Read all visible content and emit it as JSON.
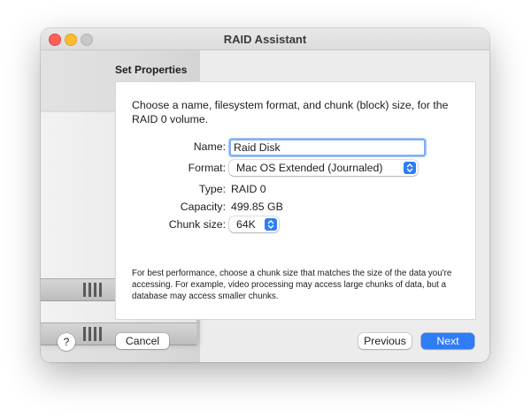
{
  "window": {
    "title": "RAID Assistant"
  },
  "panel": {
    "heading": "Set Properties",
    "intro": "Choose a name, filesystem format, and chunk (block) size, for the RAID 0 volume.",
    "note": "For best performance, choose a chunk size that matches the size of the data you're accessing. For example, video processing may access large chunks of data, but a database may access smaller chunks."
  },
  "form": {
    "name_label": "Name:",
    "name_value": "Raid Disk",
    "format_label": "Format:",
    "format_value": "Mac OS Extended (Journaled)",
    "type_label": "Type:",
    "type_value": "RAID 0",
    "capacity_label": "Capacity:",
    "capacity_value": "499.85 GB",
    "chunk_label": "Chunk size:",
    "chunk_value": "64K"
  },
  "buttons": {
    "help": "?",
    "cancel": "Cancel",
    "previous": "Previous",
    "next": "Next"
  },
  "colors": {
    "accent": "#2f7cf6",
    "close": "#ff5f57",
    "minimize": "#febc2e",
    "focus_ring": "#7fb0f5"
  },
  "icons": {
    "stepper": "chevron-up-down-icon",
    "help": "question-mark-icon"
  }
}
